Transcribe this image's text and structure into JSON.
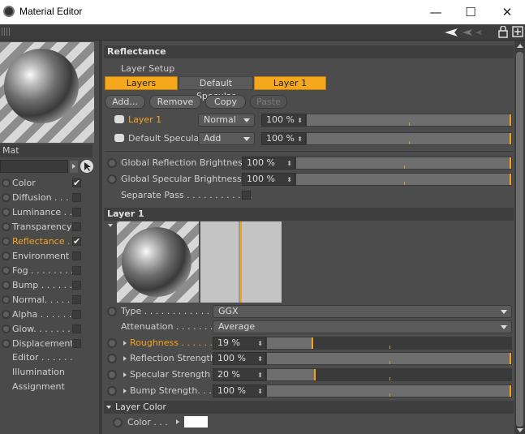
{
  "window": {
    "title": "Material Editor",
    "minimize": "—",
    "maximize": "☐",
    "close": "✕"
  },
  "material": {
    "name": "Mat"
  },
  "channels": [
    {
      "label": "Color",
      "checked": true
    },
    {
      "label": "Diffusion . . . .",
      "checked": false
    },
    {
      "label": "Luminance . .",
      "checked": false
    },
    {
      "label": "Transparency",
      "checked": false
    },
    {
      "label": "Reflectance . .",
      "checked": true,
      "active": true
    },
    {
      "label": "Environment",
      "checked": false
    },
    {
      "label": "Fog . . . . . . . .",
      "checked": false
    },
    {
      "label": "Bump . . . . . .",
      "checked": false
    },
    {
      "label": "Normal. . . . .",
      "checked": false
    },
    {
      "label": "Alpha . . . . . .",
      "checked": false
    },
    {
      "label": "Glow. . . . . . .",
      "checked": false
    },
    {
      "label": "Displacement",
      "checked": false
    }
  ],
  "extra_items": [
    "Editor . . . . . .",
    "Illumination",
    "Assignment"
  ],
  "reflectance": {
    "header": "Reflectance",
    "layer_setup": "Layer Setup",
    "tabs": [
      "Layers",
      "Default Specular",
      "Layer 1"
    ],
    "buttons": {
      "add": "Add...",
      "remove": "Remove",
      "copy": "Copy",
      "paste": "Paste"
    },
    "layers": [
      {
        "name": "Layer 1",
        "mode": "Normal",
        "amount": "100 %",
        "amount_fraction": 1.0
      },
      {
        "name": "Default Specular",
        "mode": "Add",
        "amount": "100 %",
        "amount_fraction": 1.0
      }
    ],
    "global_reflection": {
      "label": "Global Reflection Brightness",
      "value": "100 %",
      "fraction": 1.0
    },
    "global_specular": {
      "label": "Global Specular Brightness",
      "value": "100 %",
      "fraction": 1.0
    },
    "separate_pass": "Separate Pass . . . . . . . . . . . ."
  },
  "layer1": {
    "header": "Layer 1",
    "type": {
      "label": "Type . . . . . . . . . . . . . . .",
      "value": "GGX"
    },
    "attenuation": {
      "label": "Attenuation . . . . . . . . .",
      "value": "Average"
    },
    "roughness": {
      "label": "Roughness . . . . . . .",
      "value": "19 %",
      "fraction": 0.19
    },
    "reflection_strength": {
      "label": "Reflection Strength",
      "value": "100 %",
      "fraction": 1.0
    },
    "specular_strength": {
      "label": "Specular Strength",
      "value": "20 %",
      "fraction": 0.2
    },
    "bump_strength": {
      "label": "Bump Strength. . . .",
      "value": "100 %",
      "fraction": 1.0
    },
    "layer_color_header": "Layer Color",
    "color_label": "Color . . ."
  },
  "colors": {
    "accent": "#f5a31d",
    "bg": "#4c4c4c",
    "field": "#3a3a3a"
  }
}
